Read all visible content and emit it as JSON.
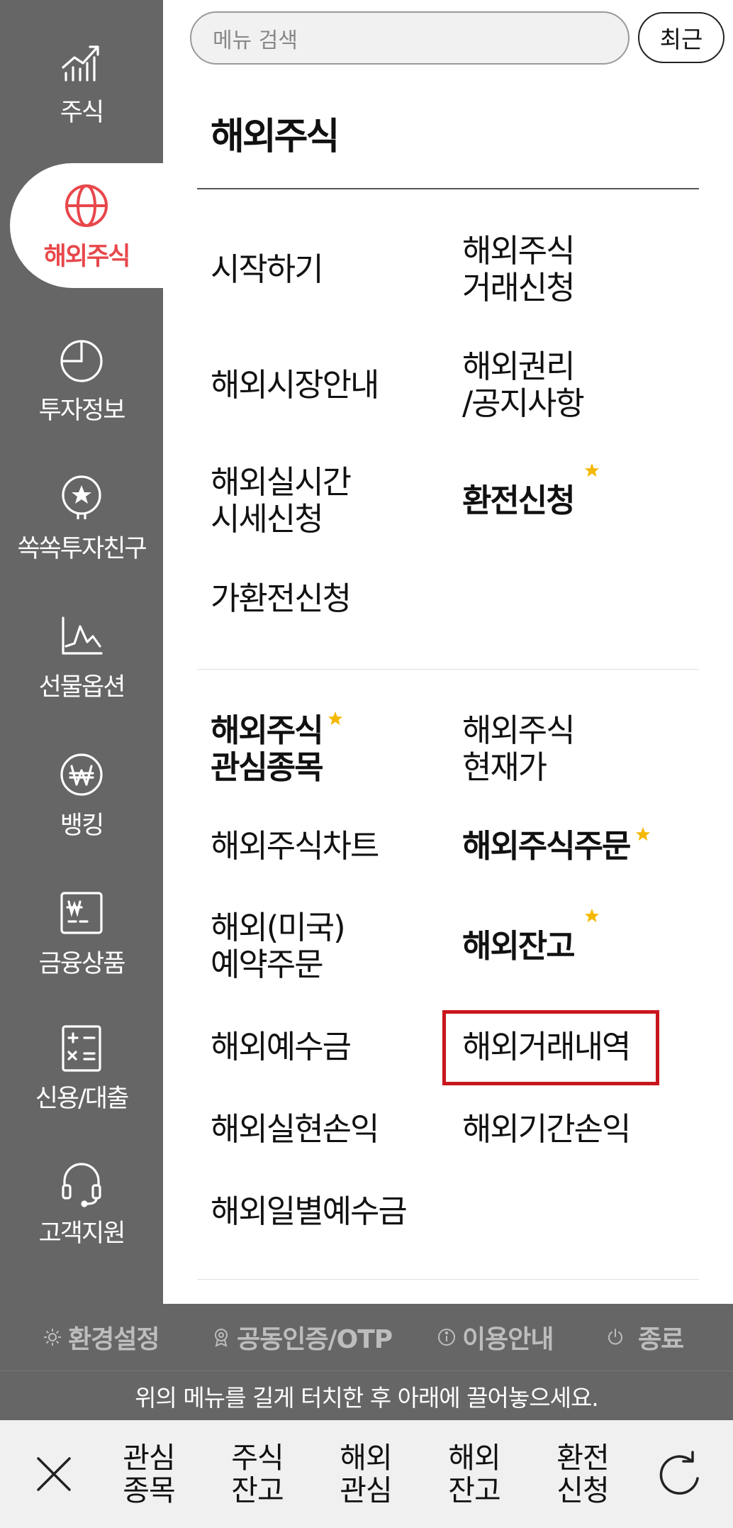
{
  "sidebar": {
    "items": [
      {
        "label": "주식",
        "icon": "stock-chart-icon"
      },
      {
        "label": "해외주식",
        "icon": "globe-icon",
        "active": true
      },
      {
        "label": "투자정보",
        "icon": "pie-chart-icon"
      },
      {
        "label": "쏙쏙투자친구",
        "icon": "star-badge-icon"
      },
      {
        "label": "선물옵션",
        "icon": "futures-chart-icon"
      },
      {
        "label": "뱅킹",
        "icon": "won-coin-icon"
      },
      {
        "label": "금융상품",
        "icon": "won-card-icon"
      },
      {
        "label": "신용/대출",
        "icon": "calculator-icon"
      },
      {
        "label": "고객지원",
        "icon": "headset-icon"
      }
    ]
  },
  "search": {
    "placeholder": "메뉴 검색",
    "recent_label": "최근"
  },
  "section": {
    "title": "해외주식"
  },
  "menu": {
    "group1": [
      {
        "label": "시작하기"
      },
      {
        "label": "해외주식\n거래신청"
      },
      {
        "label": "해외시장안내"
      },
      {
        "label": "해외권리\n/공지사항"
      },
      {
        "label": "해외실시간\n시세신청"
      },
      {
        "label": "환전신청",
        "bold": true,
        "starred": true
      },
      {
        "label": "가환전신청"
      }
    ],
    "group2": [
      {
        "label": "해외주식\n관심종목",
        "bold": true,
        "starred": true
      },
      {
        "label": "해외주식\n현재가"
      },
      {
        "label": "해외주식차트"
      },
      {
        "label": "해외주식주문",
        "bold": true,
        "starred": true
      },
      {
        "label": "해외(미국)\n예약주문"
      },
      {
        "label": "해외잔고",
        "bold": true,
        "starred": true
      },
      {
        "label": "해외예수금"
      },
      {
        "label": "해외거래내역",
        "highlighted": true
      },
      {
        "label": "해외실현손익"
      },
      {
        "label": "해외기간손익"
      },
      {
        "label": "해외일별예수금"
      }
    ]
  },
  "settings_bar": {
    "items": [
      {
        "label": "환경설정",
        "icon": "gear-icon"
      },
      {
        "label": "공동인증/OTP",
        "icon": "certificate-icon"
      },
      {
        "label": "이용안내",
        "icon": "info-icon"
      },
      {
        "label": "종료",
        "icon": "power-icon"
      }
    ]
  },
  "hint": "위의 메뉴를 길게 터치한 후 아래에 끌어놓으세요.",
  "quick_bar": {
    "items": [
      {
        "label": "관심\n종목"
      },
      {
        "label": "주식\n잔고"
      },
      {
        "label": "해외\n관심"
      },
      {
        "label": "해외\n잔고"
      },
      {
        "label": "환전\n신청"
      }
    ]
  },
  "colors": {
    "sidebar_bg": "#666666",
    "active_accent": "#e8474b",
    "star": "#f5b800",
    "highlight_border": "#c8161d"
  }
}
